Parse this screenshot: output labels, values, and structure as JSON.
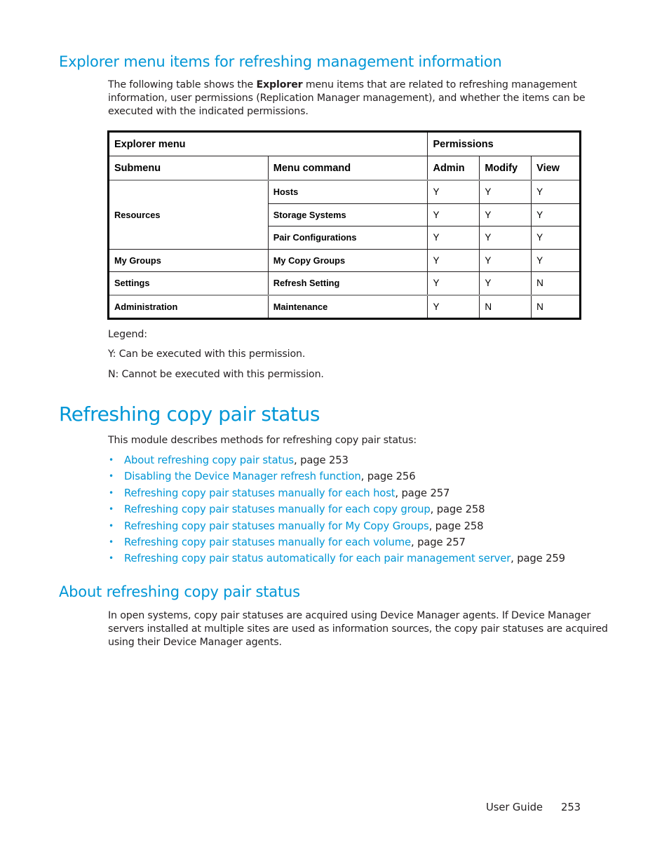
{
  "section1": {
    "title": "Explorer menu items for refreshing management information",
    "intro_before": "The following table shows the ",
    "intro_bold": "Explorer",
    "intro_after_line1": " menu items that are related to refreshing management",
    "intro_line2": "information, user permissions (Replication Manager management), and whether the items can be",
    "intro_line3": "executed with the indicated permissions."
  },
  "table": {
    "header1": {
      "explorer_menu": "Explorer menu",
      "permissions": "Permissions"
    },
    "header2": {
      "submenu": "Submenu",
      "menu_command": "Menu command",
      "admin": "Admin",
      "modify": "Modify",
      "view": "View"
    },
    "rows": [
      {
        "submenu": "Resources",
        "command": "Hosts",
        "admin": "Y",
        "modify": "Y",
        "view": "Y"
      },
      {
        "submenu": "",
        "command": "Storage Systems",
        "admin": "Y",
        "modify": "Y",
        "view": "Y"
      },
      {
        "submenu": "",
        "command": "Pair Configurations",
        "admin": "Y",
        "modify": "Y",
        "view": "Y"
      },
      {
        "submenu": "My Groups",
        "command": "My Copy Groups",
        "admin": "Y",
        "modify": "Y",
        "view": "Y"
      },
      {
        "submenu": "Settings",
        "command": "Refresh Setting",
        "admin": "Y",
        "modify": "Y",
        "view": "N"
      },
      {
        "submenu": "Administration",
        "command": "Maintenance",
        "admin": "Y",
        "modify": "N",
        "view": "N"
      }
    ]
  },
  "legend": {
    "title": "Legend:",
    "y": "Y: Can be executed with this permission.",
    "n": "N: Cannot be executed with this permission."
  },
  "section2": {
    "title": "Refreshing copy pair status",
    "intro": "This module describes methods for refreshing copy pair status:",
    "bullet_glyph": "•",
    "links": [
      {
        "text": "About refreshing copy pair status",
        "page": ", page 253"
      },
      {
        "text": "Disabling the Device Manager refresh function",
        "page": ", page 256"
      },
      {
        "text": "Refreshing copy pair statuses manually for each host",
        "page": ", page 257"
      },
      {
        "text": "Refreshing copy pair statuses manually for each copy group",
        "page": ", page 258"
      },
      {
        "text": "Refreshing copy pair statuses manually for My Copy Groups",
        "page": ", page 258"
      },
      {
        "text": "Refreshing copy pair statuses manually for each volume",
        "page": ", page 257"
      },
      {
        "text": "Refreshing copy pair status automatically for each pair management server",
        "page": ", page 259"
      }
    ]
  },
  "section3": {
    "title": "About refreshing copy pair status",
    "line1": "In open systems, copy pair statuses are acquired using Device Manager agents. If Device Manager",
    "line2": "servers installed at multiple sites are used as information sources, the copy pair statuses are acquired",
    "line3": "using their Device Manager agents."
  },
  "footer": {
    "guide": "User Guide",
    "page_number": "253"
  },
  "colors": {
    "heading": "#0096d6",
    "link": "#0096d6",
    "text": "#231f20"
  }
}
